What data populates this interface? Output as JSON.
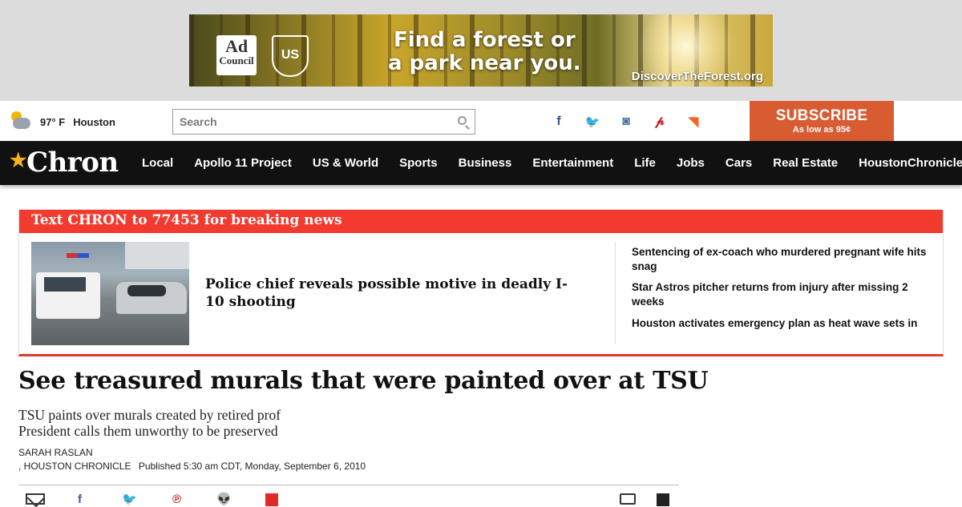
{
  "ad": {
    "advertiser_logo": "Ad Council",
    "advertiser_logo_top": "Ad",
    "advertiser_logo_bottom": "Council",
    "partner_logo": "US",
    "headline_line1": "Find a forest or",
    "headline_line2": "a park near you.",
    "url": "DiscoverTheForest.org"
  },
  "weather": {
    "icon": "partly-cloudy-icon",
    "temp": "97° F",
    "city": "Houston"
  },
  "search": {
    "placeholder": "Search"
  },
  "social": [
    {
      "name": "facebook-icon",
      "glyph": "f",
      "color": "#3b5998"
    },
    {
      "name": "twitter-icon",
      "glyph": "🐦",
      "color": "#1da1f2"
    },
    {
      "name": "instagram-icon",
      "glyph": "◙",
      "color": "#3f729b"
    },
    {
      "name": "pinterest-icon",
      "glyph": "𝓅",
      "color": "#cb2027"
    },
    {
      "name": "rss-icon",
      "glyph": "◥",
      "color": "#f26522"
    }
  ],
  "subscribe": {
    "label": "SUBSCRIBE",
    "sub": "As low as 95¢",
    "color": "#d95b32"
  },
  "nav": {
    "logo": "Chron",
    "items": [
      "Local",
      "Apollo 11 Project",
      "US & World",
      "Sports",
      "Business",
      "Entertainment",
      "Life",
      "Jobs",
      "Cars",
      "Real Estate",
      "HoustonChronicle.com"
    ]
  },
  "breaking": {
    "header": "Text CHRON to 77453 for breaking news",
    "accent": "#f23b2e",
    "lead_headline": "Police chief reveals possible motive in deadly I-10 shooting",
    "side_items": [
      "Sentencing of ex-coach who murdered pregnant wife hits snag",
      "Star Astros pitcher returns from injury after missing 2 weeks",
      "Houston activates emergency plan as heat wave sets in"
    ]
  },
  "article": {
    "headline": "See treasured murals that were painted over at TSU",
    "dek_line1": "TSU paints over murals created by retired prof",
    "dek_line2": "President calls them unworthy to be preserved",
    "author": "SARAH RASLAN",
    "outlet": ", HOUSTON CHRONICLE",
    "published": "Published 5:30 am CDT, Monday, September 6, 2010"
  },
  "share_icons": [
    "email-icon",
    "facebook-icon",
    "twitter-icon",
    "pinterest-icon",
    "reddit-icon",
    "flipboard-icon",
    "print-icon",
    "comments-icon"
  ]
}
